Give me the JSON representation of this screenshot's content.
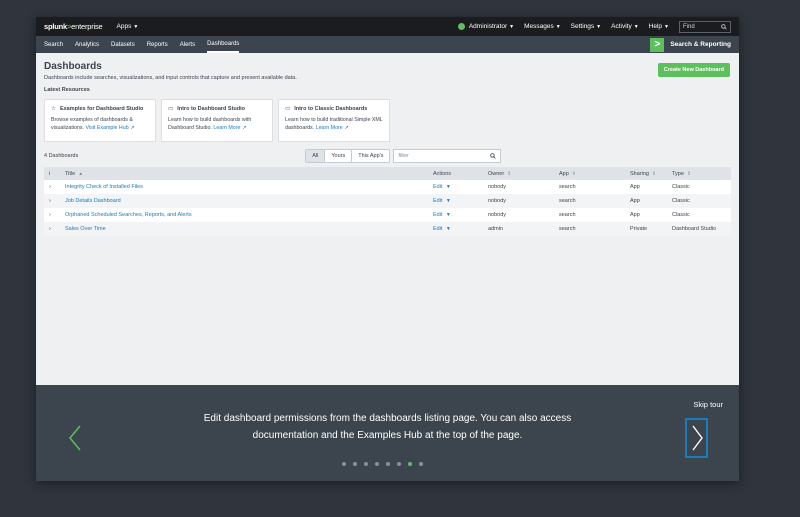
{
  "topbar": {
    "logo_main": "splunk",
    "logo_gt": ">",
    "logo_suffix": "enterprise",
    "apps": "Apps",
    "administrator": "Administrator",
    "messages": "Messages",
    "settings": "Settings",
    "activity": "Activity",
    "help": "Help",
    "find_placeholder": "Find"
  },
  "appbar": {
    "nav": [
      "Search",
      "Analytics",
      "Datasets",
      "Reports",
      "Alerts",
      "Dashboards"
    ],
    "active": "Dashboards",
    "app_name": "Search & Reporting"
  },
  "page": {
    "title": "Dashboards",
    "subtitle": "Dashboards include searches, visualizations, and input controls that capture and present available data.",
    "latest_resources": "Latest Resources",
    "create_button": "Create New Dashboard"
  },
  "cards": [
    {
      "title": "Examples for Dashboard Studio",
      "body": "Browse examples of dashboards & visualizations.",
      "link": "Visit Example Hub"
    },
    {
      "title": "Intro to Dashboard Studio",
      "body": "Learn how to build dashboards with Dashboard Studio.",
      "link": "Learn More"
    },
    {
      "title": "Intro to Classic Dashboards",
      "body": "Learn how to build traditional Simple XML dashboards.",
      "link": "Learn More"
    }
  ],
  "list": {
    "count": "4 Dashboards",
    "filters": [
      "All",
      "Yours",
      "This App's"
    ],
    "filter_placeholder": "filter"
  },
  "table": {
    "headers": {
      "i": "i",
      "title": "Title",
      "actions": "Actions",
      "owner": "Owner",
      "app": "App",
      "sharing": "Sharing",
      "type": "Type"
    },
    "rows": [
      {
        "title": "Integrity Check of Installed Files",
        "action": "Edit",
        "owner": "nobody",
        "app": "search",
        "sharing": "App",
        "type": "Classic"
      },
      {
        "title": "Job Details Dashboard",
        "action": "Edit",
        "owner": "nobody",
        "app": "search",
        "sharing": "App",
        "type": "Classic"
      },
      {
        "title": "Orphaned Scheduled Searches, Reports, and Alerts",
        "action": "Edit",
        "owner": "nobody",
        "app": "search",
        "sharing": "App",
        "type": "Classic"
      },
      {
        "title": "Sales Over Time",
        "action": "Edit",
        "owner": "admin",
        "app": "search",
        "sharing": "Private",
        "type": "Dashboard Studio"
      }
    ]
  },
  "tour": {
    "skip": "Skip tour",
    "line1": "Edit dashboard permissions from the dashboards listing page. You can also access",
    "line2": "documentation and the Examples Hub at the top of the page.",
    "total_steps": 8,
    "current_step": 7
  },
  "colors": {
    "accent_green": "#5cc05c",
    "link_blue": "#1a7bbd",
    "topbar": "#1a1c20",
    "appbar": "#3c444d"
  }
}
